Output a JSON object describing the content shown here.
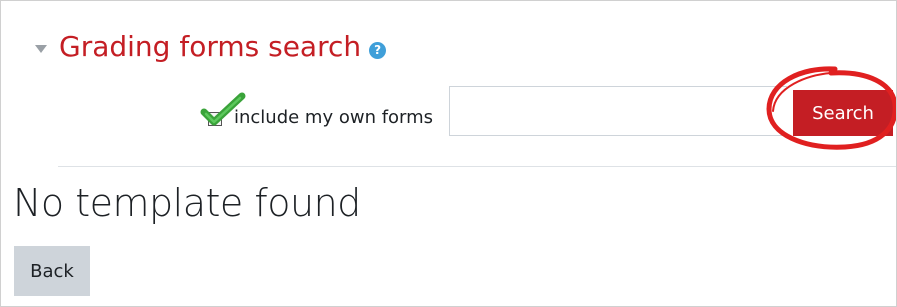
{
  "section": {
    "title": "Grading forms search",
    "collapse_icon": "caret-down-icon",
    "help_icon_glyph": "?"
  },
  "search": {
    "checkbox_label": "include my own forms",
    "checkbox_checked": true,
    "input_value": "",
    "button_label": "Search"
  },
  "result": {
    "message": "No template found"
  },
  "actions": {
    "back_label": "Back"
  },
  "colors": {
    "title_red": "#c41e24",
    "button_red": "#c41e24",
    "help_blue": "#3f9fd9",
    "back_gray": "#ced4da",
    "checkmark_green": "#3aa33a",
    "annotation_red": "#e02020"
  }
}
